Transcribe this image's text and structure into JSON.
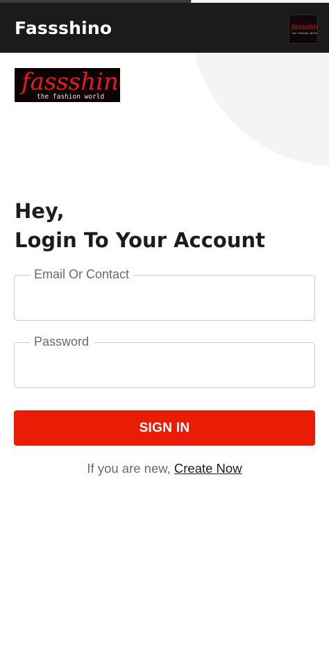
{
  "app_bar": {
    "title": "Fassshino",
    "logo": {
      "wordmark": "fassshino",
      "tagline": "the fashion world"
    }
  },
  "brand_logo": {
    "wordmark": "fassshino",
    "tagline": "the fashion world"
  },
  "heading": {
    "line1": "Hey,",
    "line2": "Login To Your Account"
  },
  "form": {
    "email_label": "Email Or Contact",
    "email_value": "",
    "password_label": "Password",
    "password_value": "",
    "submit_label": "SIGN IN"
  },
  "signup": {
    "prompt": "If you are new,",
    "link": "Create Now"
  },
  "colors": {
    "app_bar": "#1b1b1b",
    "accent": "#ea1c06",
    "logo_red": "#e01e1e",
    "field_border": "#c9c9c9"
  }
}
